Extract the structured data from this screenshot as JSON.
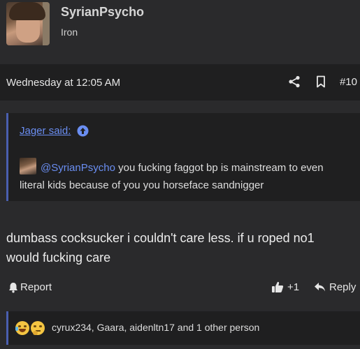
{
  "user": {
    "name": "SyrianPsycho",
    "title": "Iron"
  },
  "post": {
    "date": "Wednesday at 12:05 AM",
    "number": "#10",
    "message": "dumbass cocksucker i couldn't care less. if u roped no1 would fucking care"
  },
  "quote": {
    "author": "Jager said:",
    "mention": "@SyrianPsycho",
    "text": " you fucking faggot bp is mainstream to even literal kids because of you you horseface sandnigger"
  },
  "actions": {
    "report_label": "Report",
    "like_count": "+1",
    "reply_label": "Reply"
  },
  "reactions": {
    "emojis": [
      "laughing-emoji",
      "thinking-emoji"
    ],
    "summary": "cyrux234, Gaara, aidenltn17 and 1 other person"
  },
  "colors": {
    "background": "#2a2a2c",
    "panel": "#1f1f20",
    "accent_link": "#6a8ef2",
    "quote_border": "#4a5fb0"
  }
}
